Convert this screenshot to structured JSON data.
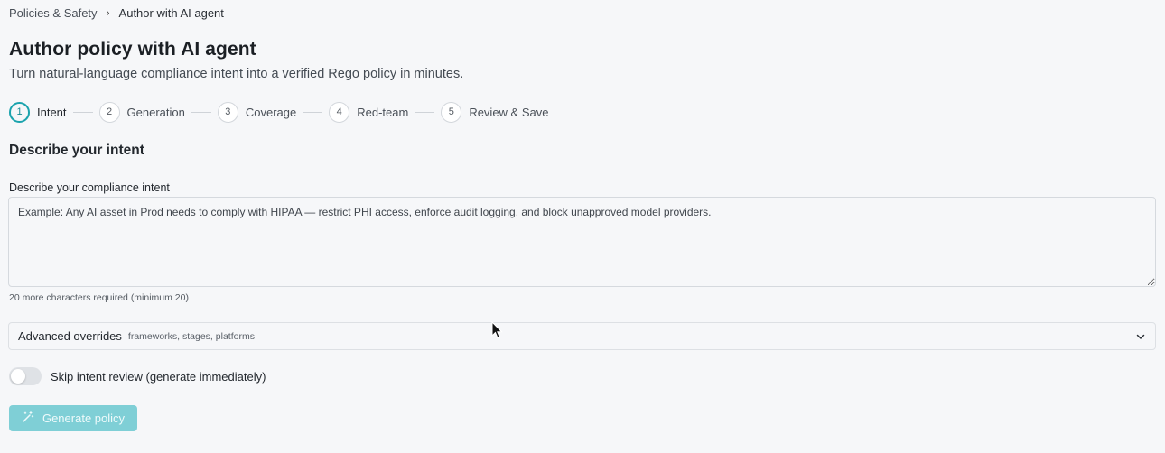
{
  "breadcrumb": {
    "parent": "Policies & Safety",
    "separator": "›",
    "current": "Author with AI agent"
  },
  "header": {
    "title": "Author policy with AI agent",
    "subtitle": "Turn natural-language compliance intent into a verified Rego policy in minutes."
  },
  "stepper": {
    "active_step": 1,
    "steps": [
      {
        "number": "1",
        "label": "Intent"
      },
      {
        "number": "2",
        "label": "Generation"
      },
      {
        "number": "3",
        "label": "Coverage"
      },
      {
        "number": "4",
        "label": "Red-team"
      },
      {
        "number": "5",
        "label": "Review & Save"
      }
    ]
  },
  "intent_section": {
    "title": "Describe your intent",
    "field_label": "Describe your compliance intent",
    "value": "",
    "placeholder": "Example: Any AI asset in Prod needs to comply with HIPAA — restrict PHI access, enforce audit logging, and block unapproved model providers.",
    "helper": "20 more characters required (minimum 20)"
  },
  "advanced": {
    "title": "Advanced overrides",
    "hint": "frameworks, stages, platforms",
    "expanded": false,
    "icon": "chevron-down-icon"
  },
  "skip_review": {
    "label": "Skip intent review (generate immediately)",
    "enabled": false
  },
  "generate": {
    "label": "Generate policy",
    "icon": "magic-wand-icon",
    "disabled": true
  },
  "colors": {
    "accent": "#1aa3ad",
    "button_disabled": "#7fcfd6",
    "background": "#f6f7f9"
  }
}
